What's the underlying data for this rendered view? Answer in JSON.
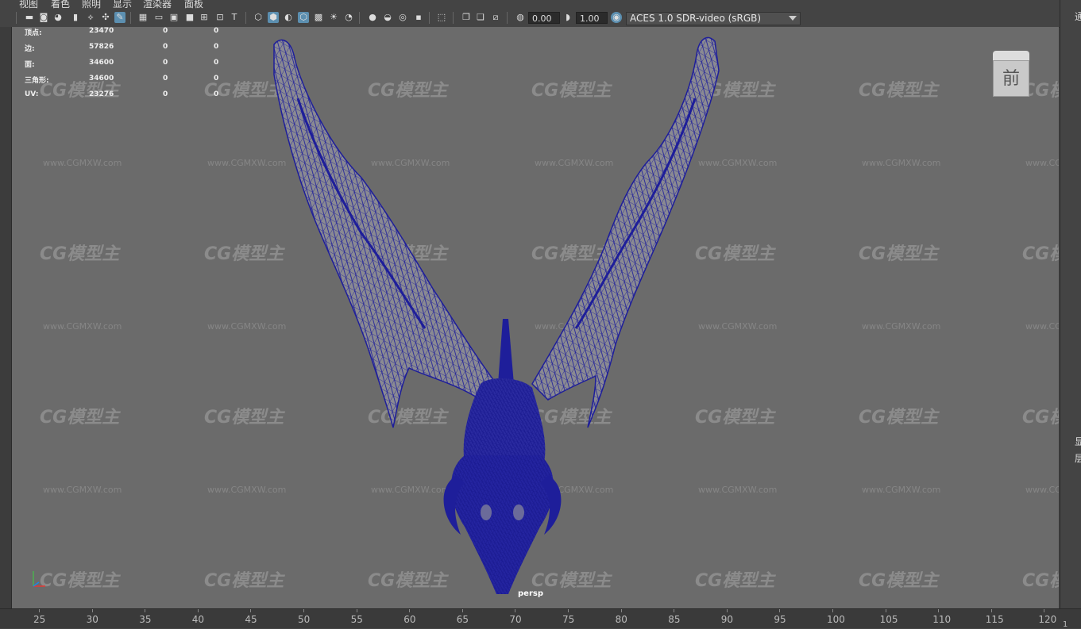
{
  "menu": [
    "视图",
    "着色",
    "照明",
    "显示",
    "渲染器",
    "面板"
  ],
  "toolbar": {
    "exposure": "0.00",
    "gamma": "1.00",
    "color_space": "ACES 1.0 SDR-video (sRGB)"
  },
  "hud": {
    "rows": [
      {
        "label": "顶点:",
        "v1": "23470",
        "v2": "0",
        "v3": "0"
      },
      {
        "label": "边:",
        "v1": "57826",
        "v2": "0",
        "v3": "0"
      },
      {
        "label": "面:",
        "v1": "34600",
        "v2": "0",
        "v3": "0"
      },
      {
        "label": "三角形:",
        "v1": "34600",
        "v2": "0",
        "v3": "0"
      },
      {
        "label": "UV:",
        "v1": "23276",
        "v2": "0",
        "v3": "0"
      }
    ]
  },
  "viewcube": {
    "face": "前"
  },
  "camera_label": "persp",
  "watermark": {
    "logo": "CG模型主",
    "url": "www.CGMXW.com"
  },
  "right_panel": {
    "t1": "通",
    "t2": "显",
    "t3": "层"
  },
  "timeline": {
    "ticks": [
      "25",
      "30",
      "35",
      "40",
      "45",
      "50",
      "55",
      "60",
      "65",
      "70",
      "75",
      "80",
      "85",
      "90",
      "95",
      "100",
      "105",
      "110",
      "115",
      "120"
    ],
    "frame": "1"
  },
  "colors": {
    "wireframe": "#1e1e9a",
    "viewport_bg": "#6b6b6b",
    "active_icon": "#5c8fb0"
  }
}
